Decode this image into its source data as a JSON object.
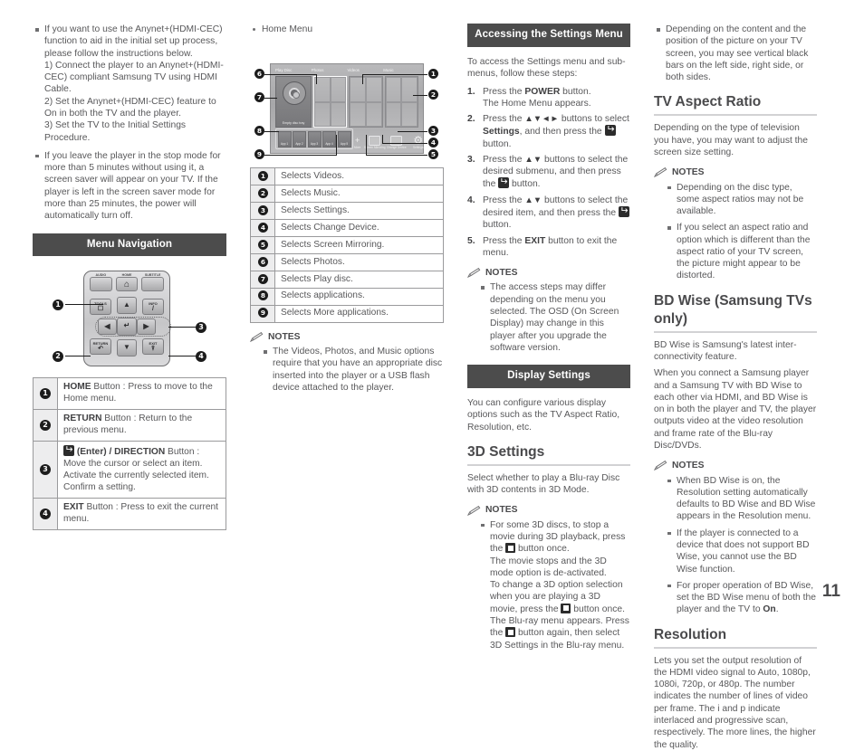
{
  "page_number": "11",
  "col1": {
    "intro_bullets": [
      {
        "text": "If you want to use the Anynet+(HDMI-CEC) function to aid in the initial set up process, please follow the instructions below.",
        "subs": [
          "1) Connect the player to an Anynet+(HDMI-CEC) compliant Samsung TV using HDMI Cable.",
          "2) Set the Anynet+(HDMI-CEC) feature to On in both the TV and the player.",
          "3) Set the TV to the Initial Settings Procedure."
        ]
      },
      {
        "text": "If you leave the player in the stop mode for more than 5 minutes without using it, a screen saver will appear on your TV. If the player is left in the screen saver mode for more than 25 minutes, the power will automatically turn off.",
        "subs": []
      }
    ],
    "section_title": "Menu Navigation",
    "remote": {
      "labels": {
        "audio": "AUDIO",
        "home": "HOME",
        "subtitle": "SUBTITLE"
      },
      "keys": {
        "tools": "TOOLS",
        "info": "INFO",
        "return": "RETURN",
        "exit": "EXIT"
      },
      "callouts": [
        "1",
        "2",
        "3",
        "4"
      ]
    },
    "button_table": [
      {
        "num": "1",
        "bold": "HOME",
        "text": " Button : Press to move to the Home menu."
      },
      {
        "num": "2",
        "bold": "RETURN",
        "text": " Button : Return to the previous menu."
      },
      {
        "num": "3",
        "bold": "(Enter) / DIRECTION",
        "text": " Button : Move the cursor or select an item. Activate the currently selected item. Confirm a setting.",
        "icon": "enter-icon"
      },
      {
        "num": "4",
        "bold": "EXIT",
        "text": " Button : Press to exit the current menu."
      }
    ]
  },
  "col2": {
    "home_menu_label": "Home Menu",
    "screen": {
      "tile_labels": [
        "Play Disc",
        "Photos",
        "Videos",
        "Music"
      ],
      "disc_tray_text": "Empty disc tray",
      "apps": [
        "App 1",
        "App 2",
        "App 3",
        "App 4",
        "App 5"
      ],
      "more_label": "More",
      "more_glyph": "+",
      "functions": [
        "Screen Mirroring",
        "Change Device",
        "Settings"
      ]
    },
    "callouts": [
      "1",
      "2",
      "3",
      "4",
      "5",
      "6",
      "7",
      "8",
      "9"
    ],
    "legend": [
      {
        "num": "1",
        "text": "Selects Videos."
      },
      {
        "num": "2",
        "text": "Selects Music."
      },
      {
        "num": "3",
        "text": "Selects Settings."
      },
      {
        "num": "4",
        "text": "Selects Change Device."
      },
      {
        "num": "5",
        "text": "Selects Screen Mirroring."
      },
      {
        "num": "6",
        "text": "Selects Photos."
      },
      {
        "num": "7",
        "text": "Selects Play disc."
      },
      {
        "num": "8",
        "text": "Selects applications."
      },
      {
        "num": "9",
        "text": "Selects More applications."
      }
    ],
    "notes_title": "NOTES",
    "notes": [
      "The Videos, Photos, and Music options require that you have an appropriate disc inserted into the player or a USB flash device attached to the player."
    ]
  },
  "col3": {
    "section_title": "Accessing the Settings Menu",
    "intro": "To access the Settings menu and sub-menus, follow these steps:",
    "steps": [
      {
        "parts": [
          {
            "t": "Press the "
          },
          {
            "t": "POWER",
            "b": true
          },
          {
            "t": " button.\nThe Home Menu appears."
          }
        ]
      },
      {
        "parts": [
          {
            "t": "Press the "
          },
          {
            "t": "▲▼◄►",
            "arrows": true
          },
          {
            "t": " buttons to select "
          },
          {
            "t": "Settings",
            "b": true
          },
          {
            "t": ", and then press the "
          },
          {
            "icon": "enter-icon"
          },
          {
            "t": " button."
          }
        ]
      },
      {
        "parts": [
          {
            "t": "Press the "
          },
          {
            "t": "▲▼",
            "arrows": true
          },
          {
            "t": " buttons to select the desired submenu, and then press the "
          },
          {
            "icon": "enter-icon"
          },
          {
            "t": " button."
          }
        ]
      },
      {
        "parts": [
          {
            "t": "Press the "
          },
          {
            "t": "▲▼",
            "arrows": true
          },
          {
            "t": " buttons to select the desired item, and then press the "
          },
          {
            "icon": "enter-icon"
          },
          {
            "t": " button."
          }
        ]
      },
      {
        "parts": [
          {
            "t": "Press the "
          },
          {
            "t": "EXIT",
            "b": true
          },
          {
            "t": " button to exit the menu."
          }
        ]
      }
    ],
    "notes_title": "NOTES",
    "notes": [
      "The access steps may differ depending on the menu you selected. The OSD (On Screen Display) may change in this player after you upgrade the software version."
    ],
    "display_title": "Display Settings",
    "display_intro": "You can configure various display options such as the TV Aspect Ratio, Resolution, etc.",
    "threed_title": "3D Settings",
    "threed_intro": "Select whether to play a Blu-ray Disc with 3D contents in 3D Mode.",
    "threed_notes_title": "NOTES",
    "threed_note_parts": [
      {
        "t": "For some 3D discs, to stop a movie during 3D playback, press the "
      },
      {
        "icon": "stop-icon"
      },
      {
        "t": " button once.\nThe movie stops and the 3D mode option is de-activated.\nTo change a 3D option selection when you are playing a 3D movie, press the "
      },
      {
        "icon": "stop-icon"
      },
      {
        "t": " button once.\nThe Blu-ray menu appears. Press the "
      },
      {
        "icon": "stop-icon"
      },
      {
        "t": " button again, then select 3D Settings in the Blu-ray menu."
      }
    ]
  },
  "col4": {
    "top_note": "Depending on the content and the position of the picture on your TV screen, you may see vertical black bars on the left side, right side, or both sides.",
    "aspect_title": "TV Aspect Ratio",
    "aspect_intro": "Depending on the type of television you have, you may want to adjust the screen size setting.",
    "aspect_notes_title": "NOTES",
    "aspect_notes": [
      "Depending on the disc type, some aspect ratios may not be available.",
      "If you select an aspect ratio and option which is different than the aspect ratio of your TV screen, the picture might appear to be distorted."
    ],
    "bdwise_title": "BD Wise (Samsung TVs only)",
    "bdwise_paras": [
      "BD Wise is Samsung's latest inter-connectivity feature.",
      "When you connect a Samsung player and a Samsung TV with BD Wise to each other via HDMI, and BD Wise is on in both the player and TV, the player outputs video at the video resolution and frame rate of the Blu-ray Disc/DVDs."
    ],
    "bdwise_notes_title": "NOTES",
    "bdwise_notes": [
      {
        "parts": [
          {
            "t": "When BD Wise is on, the Resolution setting automatically defaults to BD Wise and BD Wise appears in the Resolution menu."
          }
        ]
      },
      {
        "parts": [
          {
            "t": "If the player is connected to a device that does not support BD Wise, you cannot use the BD Wise function."
          }
        ]
      },
      {
        "parts": [
          {
            "t": "For proper operation of BD Wise, set the BD Wise menu of both the player and the TV to "
          },
          {
            "t": "On",
            "b": true
          },
          {
            "t": "."
          }
        ]
      }
    ],
    "resolution_title": "Resolution",
    "resolution_text": "Lets you set the output resolution of the HDMI video signal to Auto, 1080p, 1080i, 720p, or 480p. The number indicates the number of lines of video per frame. The i and p indicate interlaced and progressive scan, respectively. The more lines, the higher the quality."
  }
}
